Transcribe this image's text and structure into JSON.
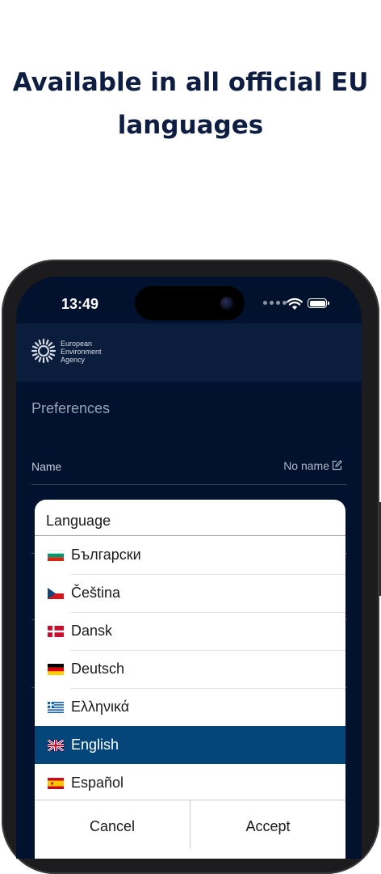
{
  "headline": {
    "line1": "Available in all official EU",
    "line2": "languages"
  },
  "status_bar": {
    "time": "13:49",
    "icons": [
      "signal-dots-icon",
      "wifi-icon",
      "battery-icon"
    ]
  },
  "app_header": {
    "logo_icon": "eea-sun-logo-icon",
    "logo_lines": [
      "European",
      "Environment",
      "Agency"
    ]
  },
  "preferences": {
    "title": "Preferences",
    "name_row": {
      "label": "Name",
      "value": "No name",
      "icon": "edit-icon"
    }
  },
  "language_dialog": {
    "title": "Language",
    "items": [
      {
        "label": "Български",
        "flag": "bg",
        "selected": false
      },
      {
        "label": "Čeština",
        "flag": "cz",
        "selected": false
      },
      {
        "label": "Dansk",
        "flag": "dk",
        "selected": false
      },
      {
        "label": "Deutsch",
        "flag": "de",
        "selected": false
      },
      {
        "label": "Ελληνικά",
        "flag": "gr",
        "selected": false
      },
      {
        "label": "English",
        "flag": "gb",
        "selected": true
      },
      {
        "label": "Español",
        "flag": "es",
        "selected": false
      }
    ],
    "cancel_label": "Cancel",
    "accept_label": "Accept"
  },
  "colors": {
    "headline": "#0e1d42",
    "screen_bg": "#02112e",
    "app_bar": "#0a1d3c",
    "selected_item": "#05467a"
  }
}
